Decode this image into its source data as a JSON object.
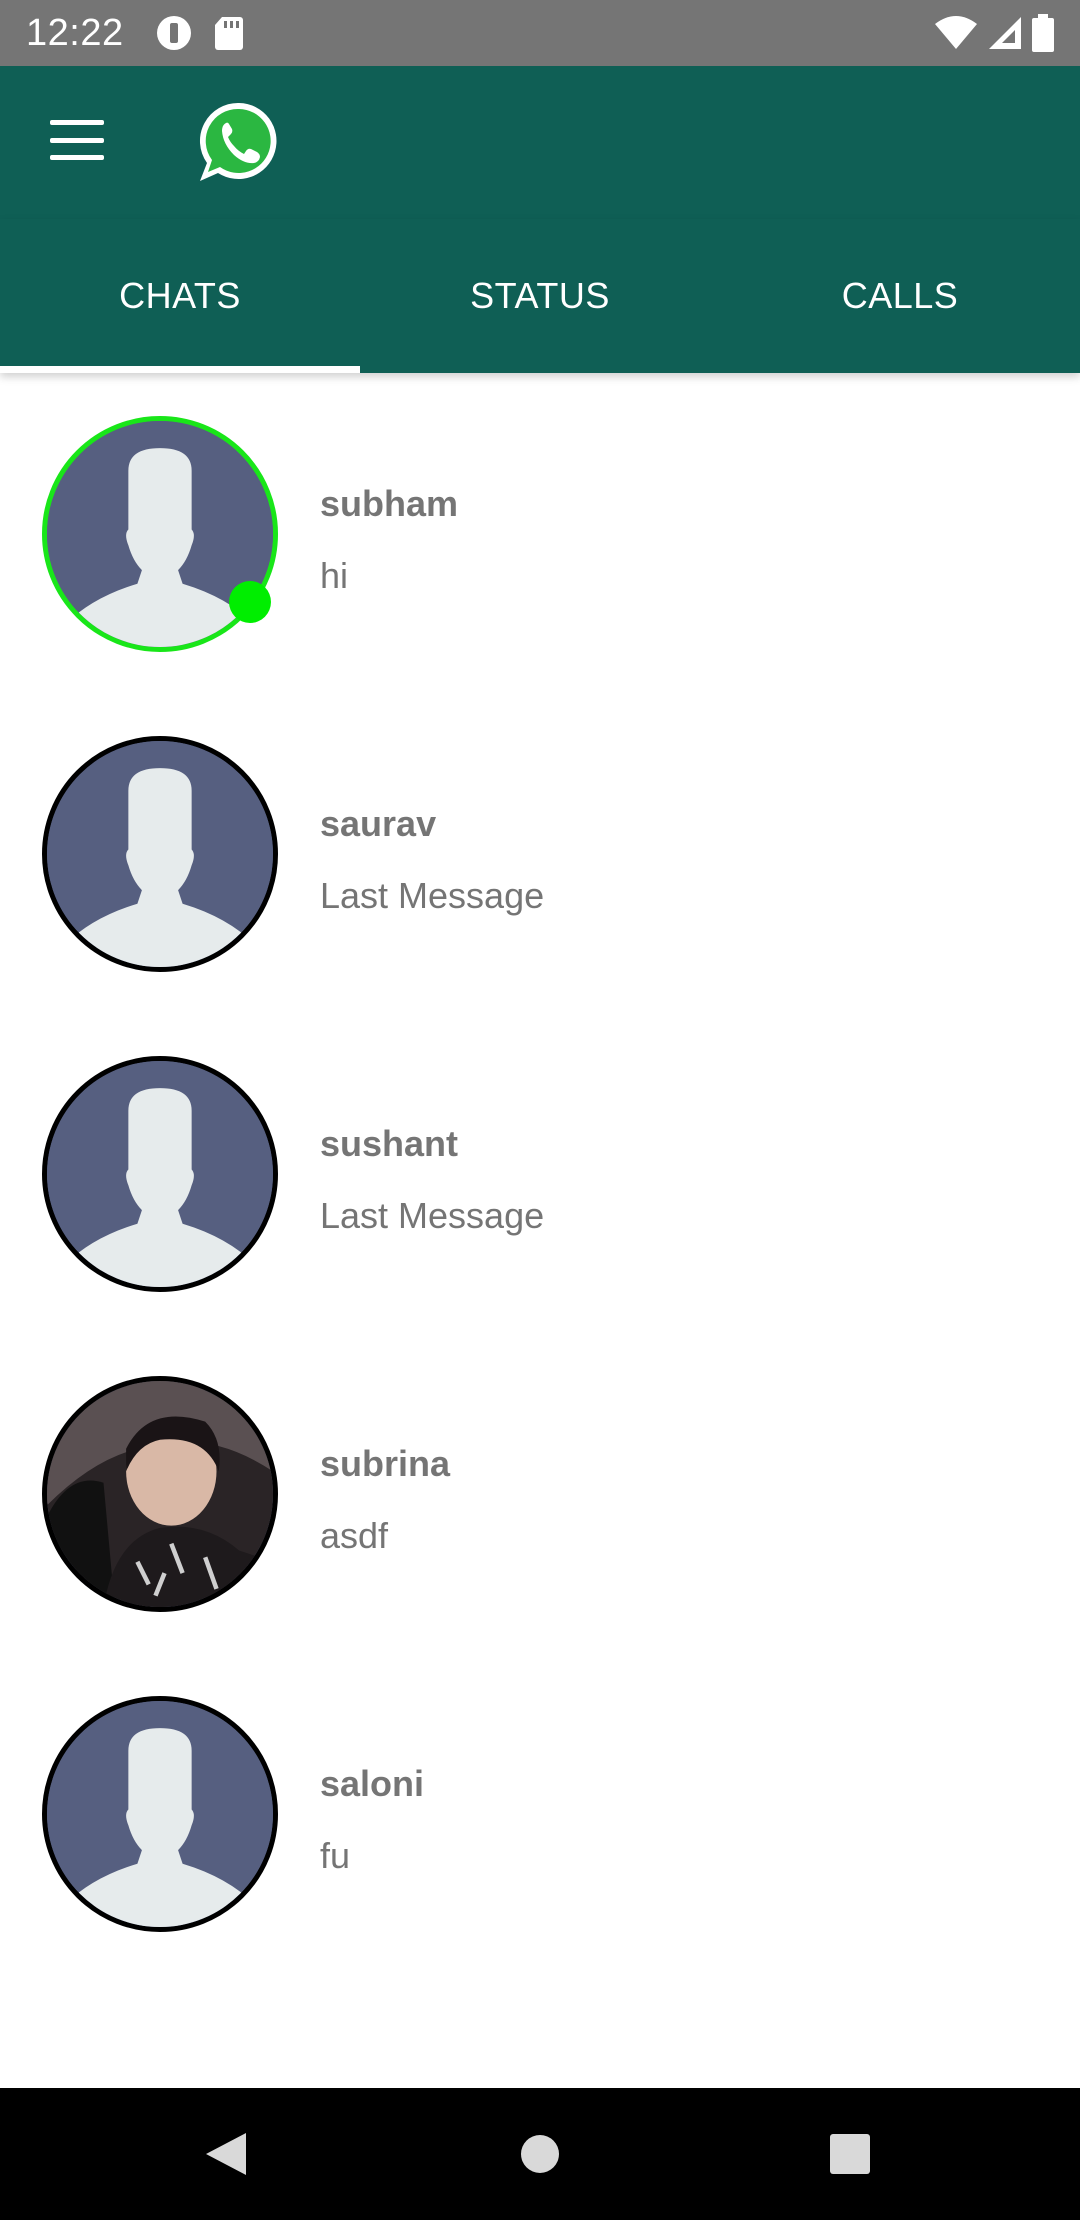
{
  "status_bar": {
    "time": "12:22",
    "icons": [
      "data-saver-icon",
      "sd-card-icon",
      "wifi-icon",
      "signal-icon",
      "battery-icon"
    ]
  },
  "app_bar": {
    "menu_icon": "hamburger-menu-icon",
    "logo": "whatsapp-logo-icon",
    "color": "#0f5f55"
  },
  "tabs": [
    {
      "label": "CHATS",
      "selected": true
    },
    {
      "label": "STATUS",
      "selected": false
    },
    {
      "label": "CALLS",
      "selected": false
    }
  ],
  "chats": [
    {
      "name": "subham",
      "last_message": "hi",
      "online": true,
      "avatar": "default-avatar"
    },
    {
      "name": "saurav",
      "last_message": "Last Message",
      "online": false,
      "avatar": "default-avatar"
    },
    {
      "name": "sushant",
      "last_message": "Last Message",
      "online": false,
      "avatar": "default-avatar"
    },
    {
      "name": "subrina",
      "last_message": "asdf",
      "online": false,
      "avatar": "photo-avatar"
    },
    {
      "name": "saloni",
      "last_message": "fu",
      "online": false,
      "avatar": "default-avatar"
    }
  ],
  "nav_bar": {
    "icons": [
      "back-icon",
      "home-icon",
      "recents-icon"
    ]
  },
  "colors": {
    "accent": "#0f5f55",
    "online": "#00ee00",
    "text_secondary": "#757575",
    "avatar_bg": "#565f80"
  }
}
